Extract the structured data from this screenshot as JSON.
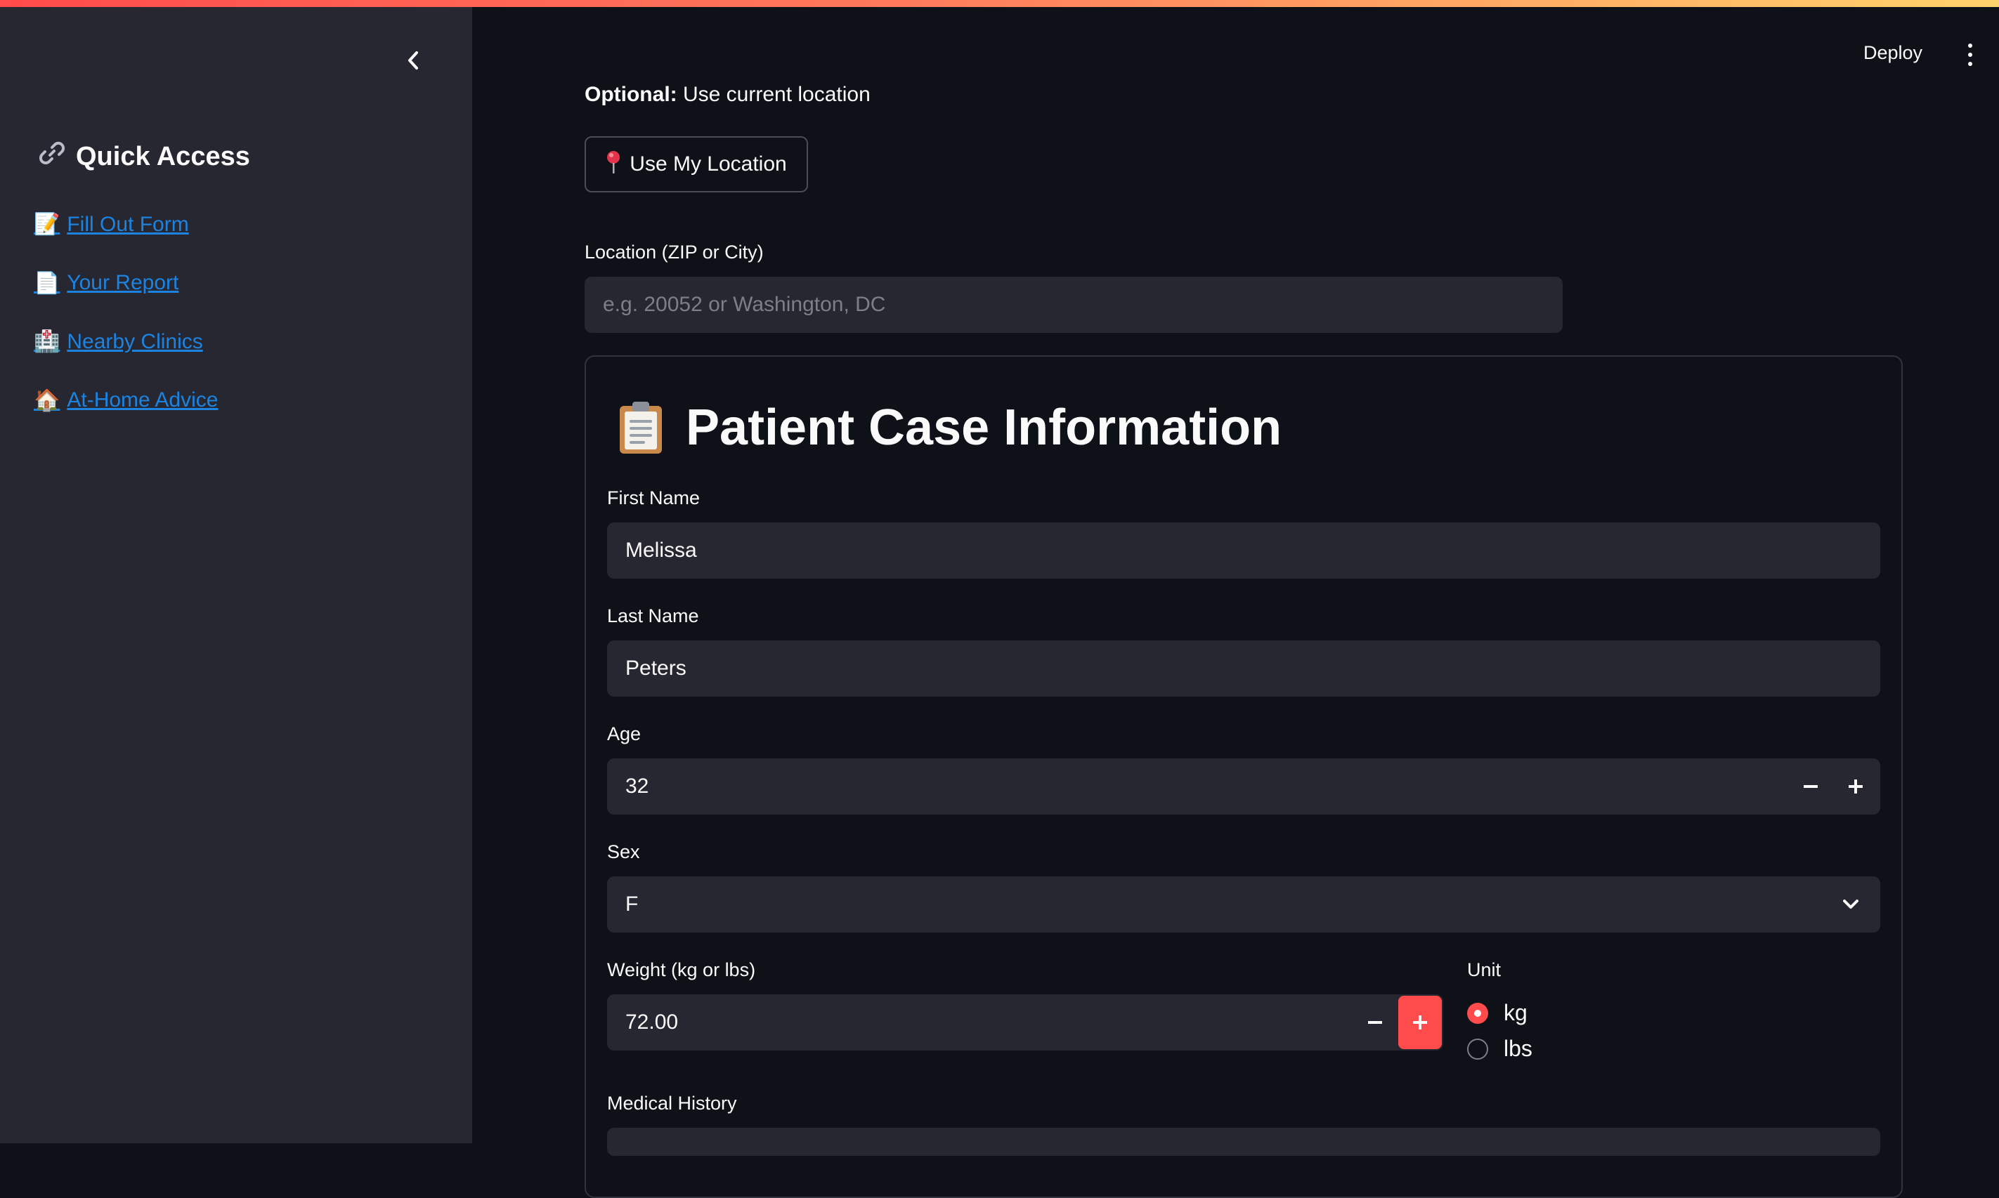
{
  "header": {
    "deploy_label": "Deploy"
  },
  "sidebar": {
    "title": "Quick Access",
    "title_icon": "link-icon",
    "links": [
      {
        "emoji": "📝",
        "label": "Fill Out Form"
      },
      {
        "emoji": "📄",
        "label": "Your Report"
      },
      {
        "emoji": "🏥",
        "label": "Nearby Clinics"
      },
      {
        "emoji": "🏠",
        "label": "At-Home Advice"
      }
    ]
  },
  "location": {
    "optional_bold": "Optional:",
    "optional_text": " Use current location",
    "use_location_label": "Use My Location",
    "field_label": "Location (ZIP or City)",
    "placeholder": "e.g. 20052 or Washington, DC",
    "value": ""
  },
  "form": {
    "title": "Patient Case Information",
    "title_icon": "clipboard-icon",
    "first_name_label": "First Name",
    "first_name": "Melissa",
    "last_name_label": "Last Name",
    "last_name": "Peters",
    "age_label": "Age",
    "age": "32",
    "sex_label": "Sex",
    "sex": "F",
    "weight_label": "Weight (kg or lbs)",
    "weight": "72.00",
    "unit_label": "Unit",
    "unit_options": [
      "kg",
      "lbs"
    ],
    "unit_selected": "kg",
    "medical_history_label": "Medical History"
  },
  "colors": {
    "accent": "#ff4b4b",
    "link": "#1c83e1",
    "background": "#0e1117",
    "sidebar": "#262730",
    "input": "#262730"
  }
}
